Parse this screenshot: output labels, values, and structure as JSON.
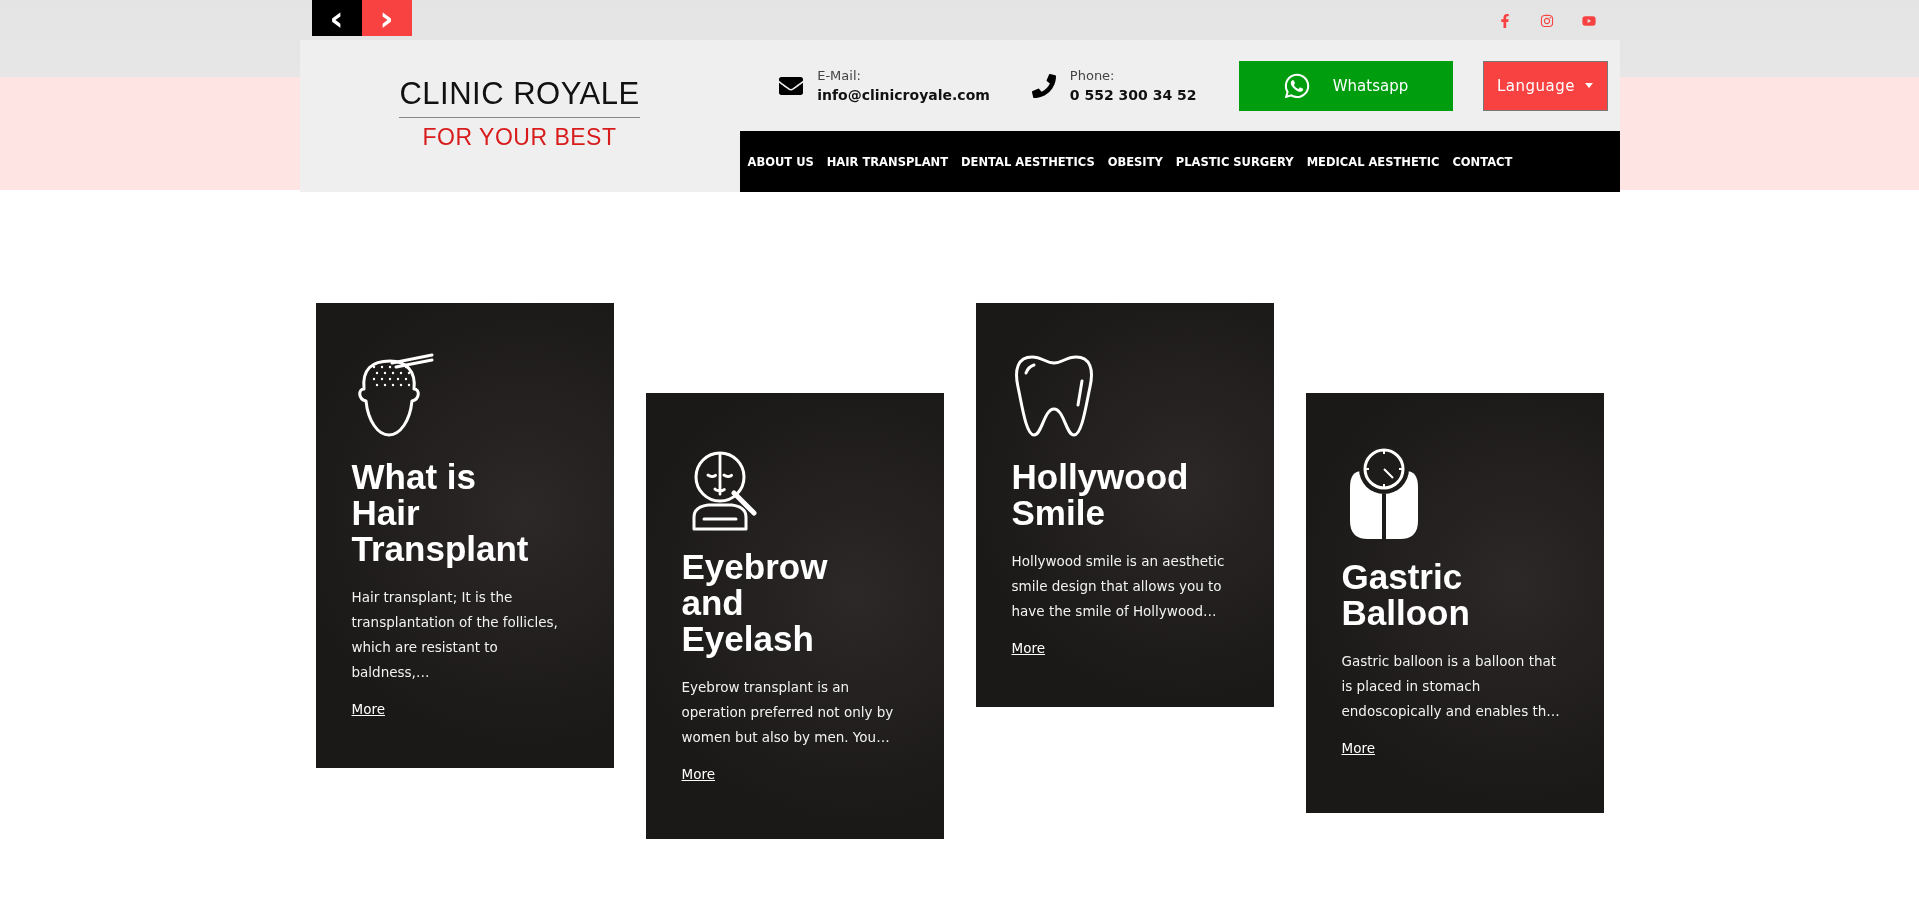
{
  "slider_arrows": {
    "previous": "‹",
    "next": "›"
  },
  "logo": {
    "name": "CLINIC ROYALE",
    "tagline": "FOR YOUR BEST"
  },
  "contacts": [
    {
      "kind": "email",
      "label": "E-Mail:",
      "value": "info@clinicroyale.com"
    },
    {
      "kind": "phone",
      "label": "Phone:",
      "value": "0 552 300 34 52"
    }
  ],
  "whatsapp_button": "Whatsapp",
  "language_button": "Language",
  "nav": [
    "ABOUT US",
    "HAIR TRANSPLANT",
    "DENTAL AESTHETICS",
    "OBESITY",
    "PLASTIC SURGERY",
    "MEDICAL AESTHETIC",
    "CONTACT"
  ],
  "cards": [
    {
      "kind": "hair",
      "title": "What is Hair Transplant",
      "text": "Hair transplant; It is the transplantation of the follicles, which are resistant to baldness,…",
      "link": "More"
    },
    {
      "kind": "face",
      "title": "Eyebrow and Eyelash",
      "text": "Eyebrow transplant is an operation preferred not only by women but also by men. You…",
      "link": "More"
    },
    {
      "kind": "tooth",
      "title": "Hollywood Smile",
      "text": "Hollywood smile is an aesthetic smile design that allows you to have the smile of Hollywood…",
      "link": "More"
    },
    {
      "kind": "scale",
      "title": "Gastric Balloon",
      "text": "Gastric balloon is a balloon that is placed in stomach endoscopically and enables th…",
      "link": "More"
    }
  ]
}
